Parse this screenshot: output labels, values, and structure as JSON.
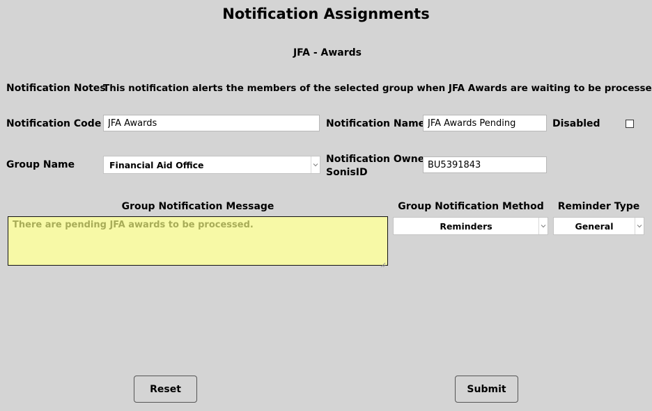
{
  "header": {
    "title": "Notification Assignments",
    "subtitle": "JFA - Awards"
  },
  "notes": {
    "label": "Notification Notes",
    "text": "This notification alerts the members of the selected group when JFA Awards are waiting to be processed."
  },
  "code": {
    "label": "Notification Code",
    "value": "JFA Awards"
  },
  "name": {
    "label": "Notification Name",
    "value": "JFA Awards Pending"
  },
  "disabled": {
    "label": "Disabled",
    "checked": false
  },
  "group": {
    "label": "Group Name",
    "selected": "Financial Aid Office"
  },
  "owner": {
    "label_line1": "Notification Owner",
    "label_line2": "SonisID",
    "value": "BU5391843"
  },
  "message": {
    "label": "Group Notification Message",
    "value": "There are pending JFA awards to be processed."
  },
  "method": {
    "label": "Group Notification Method",
    "selected": "Reminders"
  },
  "reminder": {
    "label": "Reminder Type",
    "selected": "General"
  },
  "buttons": {
    "reset": "Reset",
    "submit": "Submit"
  },
  "icons": {
    "dropdown": "chevron-down-icon",
    "resize": "resize-grip-icon"
  },
  "colors": {
    "background": "#d4d4d4",
    "message_bg": "#f7f9a6",
    "message_text": "#a8ac58"
  }
}
